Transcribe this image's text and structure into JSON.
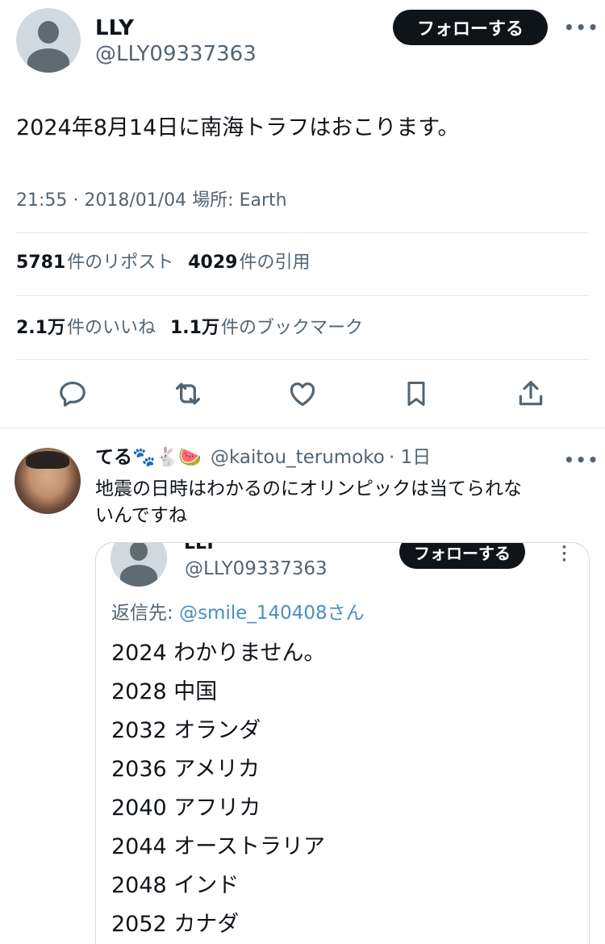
{
  "tweet": {
    "display_name": "LLY",
    "handle": "@LLY09337363",
    "follow_label": "フォローする",
    "more_icon": "more-dots-icon",
    "text": "2024年8月14日に南海トラフはおこります。",
    "meta": "21:55 · 2018/01/04 場所: Earth",
    "stats_row1": [
      {
        "value": "5781",
        "label": "件のリポスト"
      },
      {
        "value": "4029",
        "label": "件の引用"
      }
    ],
    "stats_row2": [
      {
        "value": "2.1万",
        "label": "件のいいね"
      },
      {
        "value": "1.1万",
        "label": "件のブックマーク"
      }
    ],
    "actions": [
      "reply-icon",
      "repost-icon",
      "like-icon",
      "bookmark-icon",
      "share-icon"
    ]
  },
  "reply": {
    "display_name": "てる🐾🐇🍉",
    "handle": "@kaitou_terumoko",
    "time": "1日",
    "text_line1": "地震の日時はわかるのにオリンピックは当てられな",
    "text_line2": "いんですね",
    "quoted": {
      "display_name": "LLY",
      "handle": "@LLY09337363",
      "follow_label": "フォローする",
      "reply_to_prefix": "返信先: ",
      "reply_to_mention": "@smile_140408さん",
      "lines": [
        "2024 わかりません。",
        "2028 中国",
        "2032 オランダ",
        "2036 アメリカ",
        "2040 アフリカ",
        "2044 オーストラリア",
        "2048 インド",
        "2052 カナダ"
      ]
    }
  },
  "colors": {
    "text": "#0f1419",
    "secondary": "#536471",
    "divider": "#e5e7ea",
    "link": "#4a8fbf",
    "button": "#0f1419"
  }
}
